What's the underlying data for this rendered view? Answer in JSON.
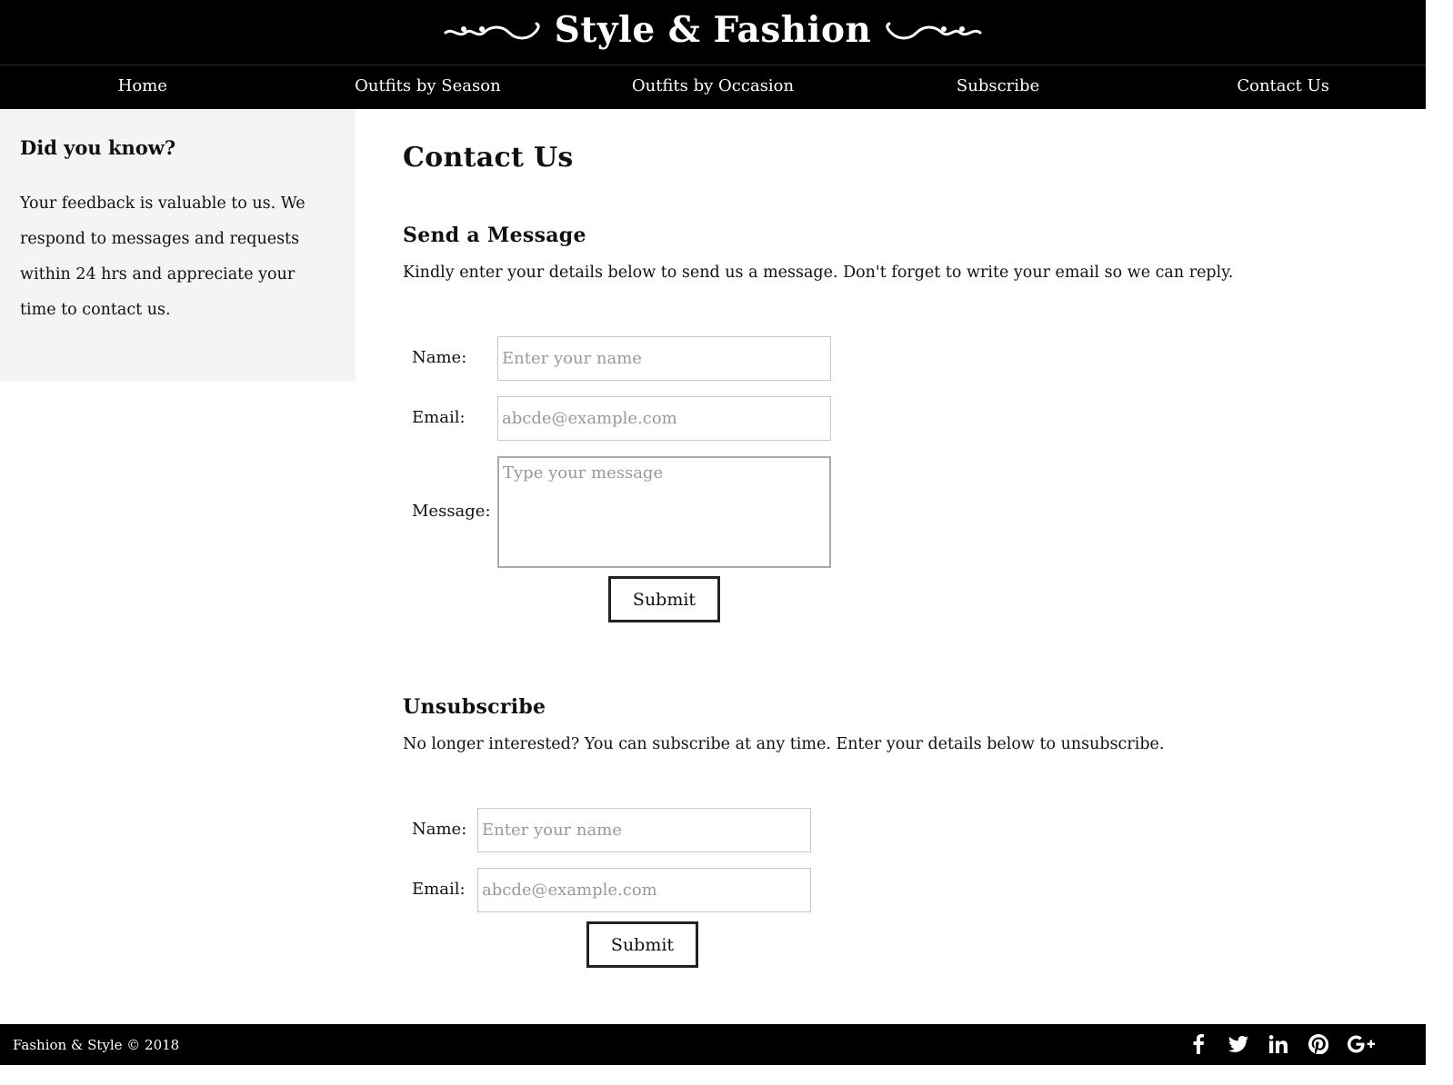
{
  "header": {
    "title": "Style & Fashion"
  },
  "nav": {
    "items": [
      {
        "label": "Home"
      },
      {
        "label": "Outfits by Season"
      },
      {
        "label": "Outfits by Occasion"
      },
      {
        "label": "Subscribe"
      },
      {
        "label": "Contact Us"
      }
    ]
  },
  "sidebar": {
    "title": "Did you know?",
    "text": "Your feedback is valuable to us. We respond to messages and requests within 24 hrs and appreciate your time to contact us."
  },
  "main": {
    "title": "Contact Us",
    "message_section": {
      "title": "Send a Message",
      "description": "Kindly enter your details below to send us a message. Don't forget to write your email so we can reply.",
      "name_label": "Name:",
      "name_placeholder": "Enter your name",
      "email_label": "Email:",
      "email_placeholder": "abcde@example.com",
      "message_label": "Message:",
      "message_placeholder": "Type your message",
      "submit_label": "Submit"
    },
    "unsubscribe_section": {
      "title": "Unsubscribe",
      "description": "No longer interested? You can subscribe at any time. Enter your details below to unsubscribe.",
      "name_label": "Name:",
      "name_placeholder": "Enter your name",
      "email_label": "Email:",
      "email_placeholder": "abcde@example.com",
      "submit_label": "Submit"
    }
  },
  "footer": {
    "copyright": "Fashion & Style © 2018",
    "social_icons": [
      "facebook-icon",
      "twitter-icon",
      "linkedin-icon",
      "pinterest-icon",
      "google-plus-icon"
    ]
  }
}
